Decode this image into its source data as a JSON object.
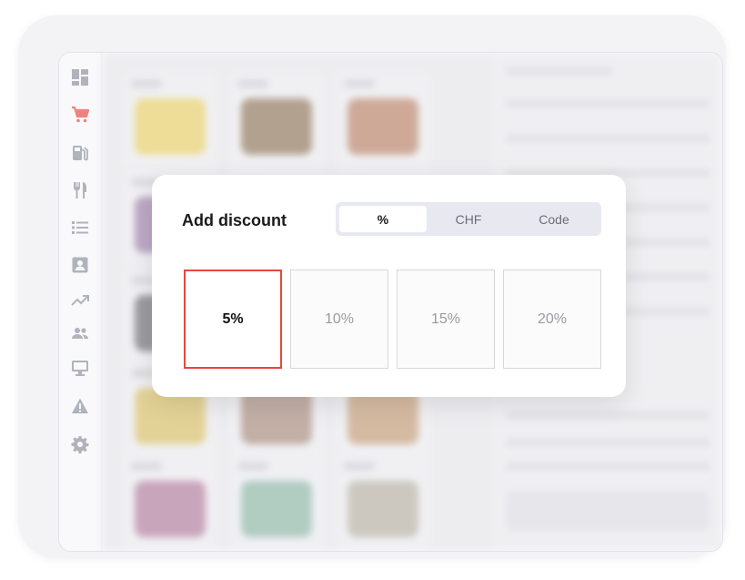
{
  "sidebar": {
    "items": [
      {
        "icon": "dashboard-icon",
        "active": false
      },
      {
        "icon": "shopping-cart-icon",
        "active": true
      },
      {
        "icon": "fuel-pump-icon",
        "active": false
      },
      {
        "icon": "cutlery-icon",
        "active": false
      },
      {
        "icon": "list-icon",
        "active": false
      },
      {
        "icon": "contact-card-icon",
        "active": false
      },
      {
        "icon": "trending-up-icon",
        "active": false
      },
      {
        "icon": "users-icon",
        "active": false
      },
      {
        "icon": "monitor-icon",
        "active": false
      },
      {
        "icon": "warning-icon",
        "active": false
      },
      {
        "icon": "gear-icon",
        "active": false
      }
    ],
    "active_color": "#e8463f",
    "icon_color": "#8a8f9c"
  },
  "modal": {
    "title": "Add discount",
    "tabs": [
      {
        "label": "%",
        "active": true
      },
      {
        "label": "CHF",
        "active": false
      },
      {
        "label": "Code",
        "active": false
      }
    ],
    "options": [
      {
        "label": "5%",
        "selected": true
      },
      {
        "label": "10%",
        "selected": false
      },
      {
        "label": "15%",
        "selected": false
      },
      {
        "label": "20%",
        "selected": false
      }
    ],
    "accent_color": "#e8463f"
  }
}
